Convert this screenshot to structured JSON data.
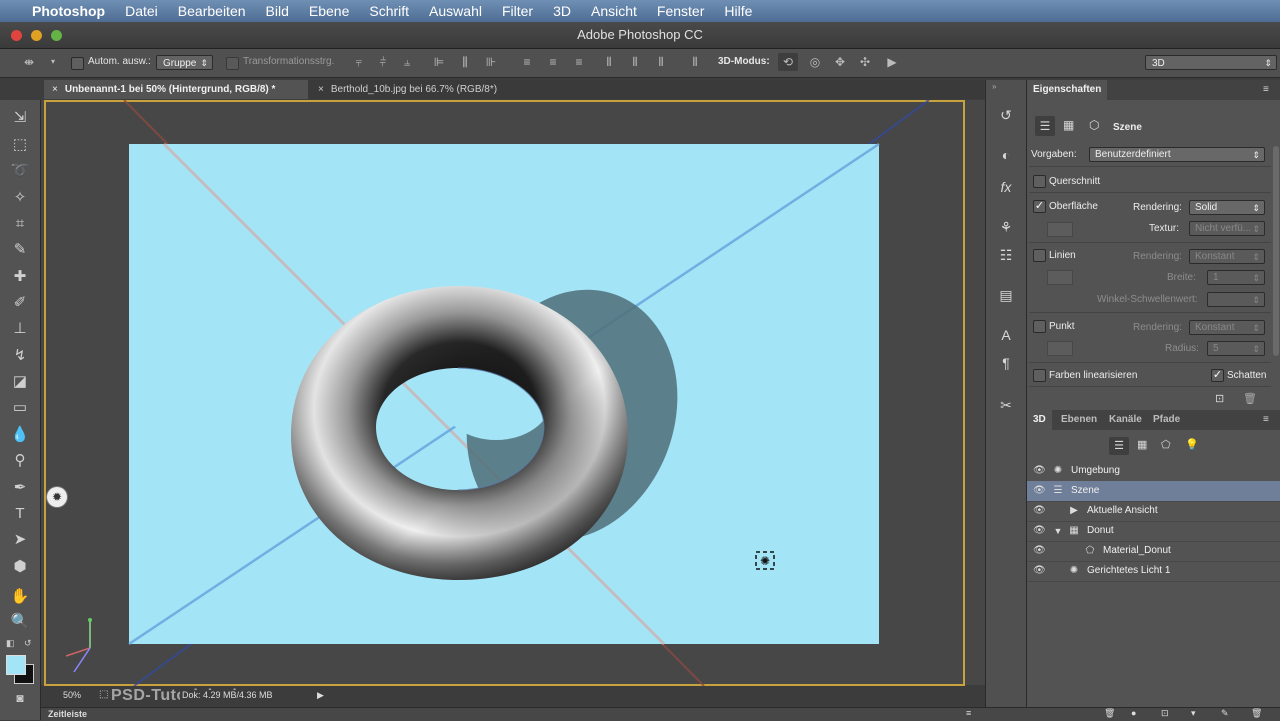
{
  "menubar": {
    "app": "Photoshop",
    "items": [
      "Datei",
      "Bearbeiten",
      "Bild",
      "Ebene",
      "Schrift",
      "Auswahl",
      "Filter",
      "3D",
      "Ansicht",
      "Fenster",
      "Hilfe"
    ]
  },
  "window": {
    "title": "Adobe Photoshop CC"
  },
  "options": {
    "auto_select_label": "Autom. ausw.:",
    "auto_select_value": "Gruppe",
    "transform_label": "Transformationsstrg.",
    "mode_label": "3D-Modus:",
    "workspace": "3D"
  },
  "tabs": [
    {
      "label": "Unbenannt-1 bei 50% (Hintergrund, RGB/8) *",
      "active": true
    },
    {
      "label": "Berthold_10b.jpg bei 66.7% (RGB/8*)",
      "active": false
    }
  ],
  "status": {
    "zoom": "50%",
    "doc": "Dok: 4.29 MB/4.36 MB"
  },
  "watermark": "PSD-Tutorials.de",
  "timeline": {
    "label": "Zeitleiste"
  },
  "properties": {
    "title": "Eigenschaften",
    "scene_label": "Szene",
    "presets_label": "Vorgaben:",
    "presets_value": "Benutzerdefiniert",
    "cross_section": "Querschnitt",
    "surface": "Oberfläche",
    "rendering_label": "Rendering:",
    "surface_rendering": "Solid",
    "texture_label": "Textur:",
    "texture_value": "Nicht verfü...",
    "lines": "Linien",
    "lines_rendering": "Konstant",
    "width_label": "Breite:",
    "width_value": "1",
    "angle_label": "Winkel-Schwellenwert:",
    "point": "Punkt",
    "point_rendering": "Konstant",
    "radius_label": "Radius:",
    "radius_value": "5",
    "linearize": "Farben linearisieren",
    "shadows": "Schatten"
  },
  "panel3d": {
    "tabs": [
      "3D",
      "Ebenen",
      "Kanäle",
      "Pfade"
    ],
    "rows": [
      {
        "label": "Umgebung",
        "icon": "environment-icon"
      },
      {
        "label": "Szene",
        "icon": "scene-icon",
        "selected": true
      },
      {
        "label": "Aktuelle Ansicht",
        "icon": "camera-icon"
      },
      {
        "label": "Donut",
        "icon": "mesh-icon"
      },
      {
        "label": "Material_Donut",
        "icon": "material-icon"
      },
      {
        "label": "Gerichtetes Licht 1",
        "icon": "light-icon"
      }
    ]
  },
  "colors": {
    "canvas": "#a3e4f6",
    "frame": "#c8a23c",
    "selected_row": "#6f7f99"
  }
}
